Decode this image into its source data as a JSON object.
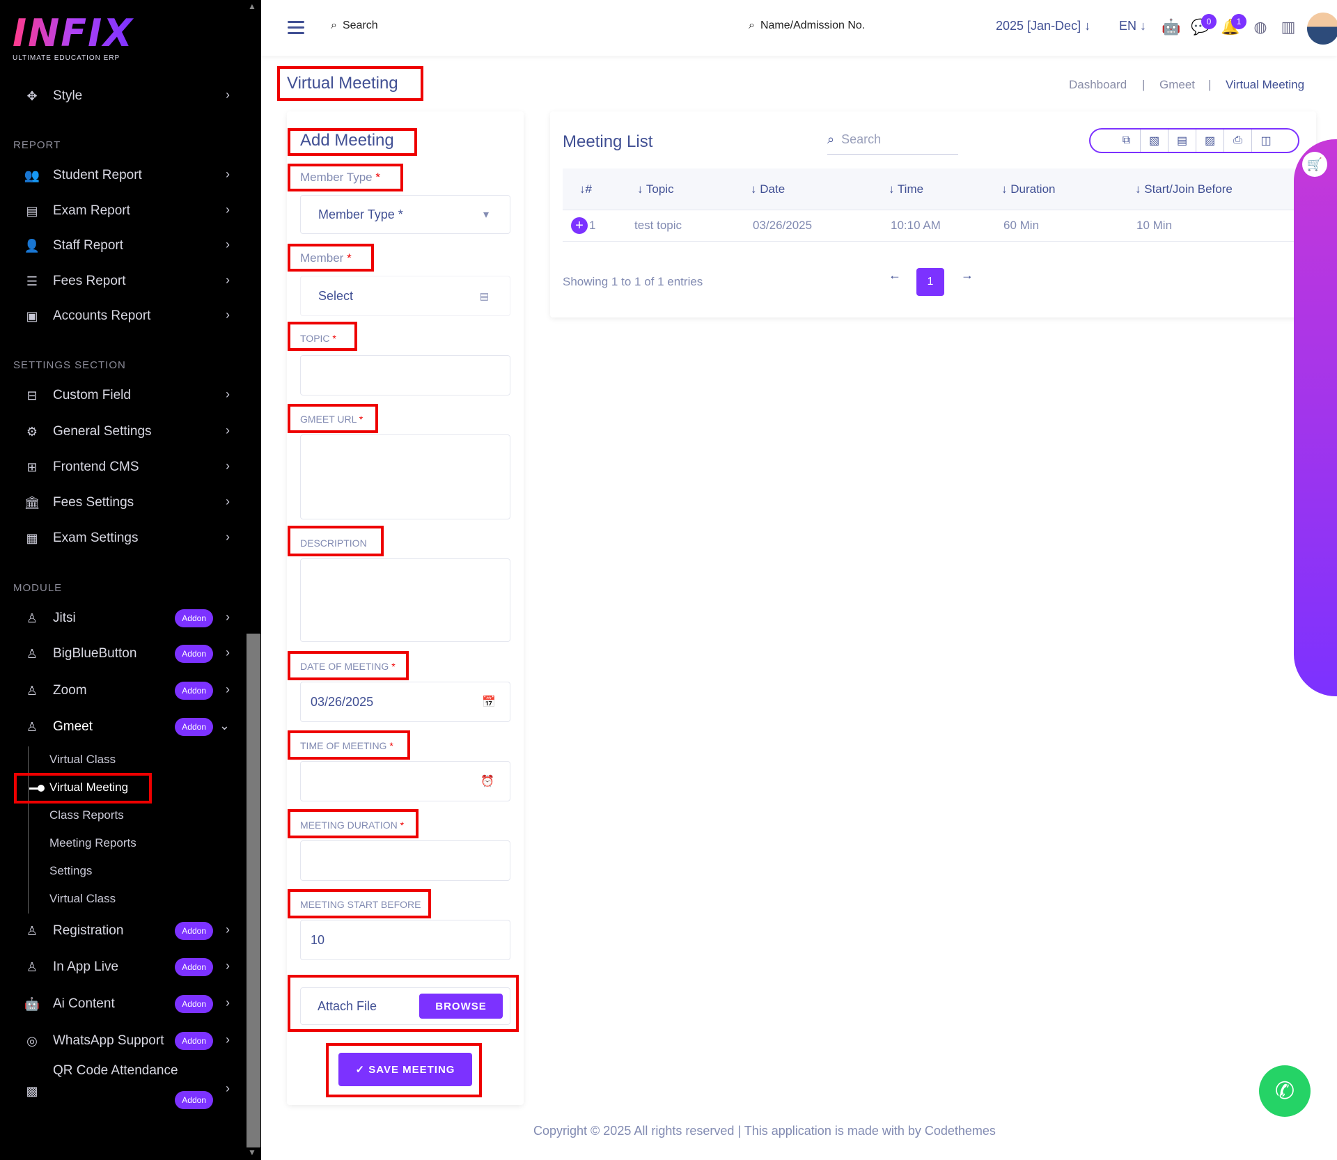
{
  "sidebar": {
    "logo": {
      "brand": "INFIX",
      "tagline": "ULTIMATE EDUCATION ERP"
    },
    "style_item": "Style",
    "sections": {
      "report": "REPORT",
      "settings": "SETTINGS SECTION",
      "module": "MODULE"
    },
    "report_items": [
      "Student Report",
      "Exam Report",
      "Staff Report",
      "Fees Report",
      "Accounts Report"
    ],
    "settings_items": [
      "Custom Field",
      "General Settings",
      "Frontend CMS",
      "Fees Settings",
      "Exam Settings"
    ],
    "module_items": [
      "Jitsi",
      "BigBlueButton",
      "Zoom",
      "Gmeet",
      "Registration",
      "In App Live",
      "Ai Content",
      "WhatsApp Support",
      "QR Code Attendance"
    ],
    "addon_label": "Addon",
    "gmeet_sub": [
      "Virtual Class",
      "Virtual Meeting",
      "Class Reports",
      "Meeting Reports",
      "Settings",
      "Virtual Class"
    ]
  },
  "header": {
    "search": "Search",
    "search2": "Name/Admission No.",
    "year": "2025 [Jan-Dec]",
    "lang": "EN",
    "msg_count": "0",
    "notif_count": "1"
  },
  "page": {
    "title": "Virtual Meeting",
    "breadcrumb": [
      "Dashboard",
      "Gmeet",
      "Virtual Meeting"
    ],
    "breadcrumb_sep": "|"
  },
  "form": {
    "title": "Add Meeting",
    "member_type_label": "Member Type",
    "member_type_value": "Member Type *",
    "member_label": "Member",
    "member_value": "Select",
    "topic_label": "TOPIC",
    "gmeet_url_label": "GMEET URL",
    "description_label": "DESCRIPTION",
    "date_label": "DATE OF MEETING",
    "date_value": "03/26/2025",
    "time_label": "TIME OF MEETING",
    "duration_label": "MEETING DURATION",
    "start_before_label": "MEETING START BEFORE",
    "start_before_value": "10",
    "attach_label": "Attach File",
    "browse": "BROWSE",
    "save": "✓ SAVE MEETING",
    "req": "*"
  },
  "list": {
    "title": "Meeting List",
    "search_placeholder": "Search",
    "columns": [
      "#",
      "Topic",
      "Date",
      "Time",
      "Duration",
      "Start/Join Before"
    ],
    "rows": [
      {
        "num": "1",
        "topic": "test topic",
        "date": "03/26/2025",
        "time": "10:10 AM",
        "duration": "60 Min",
        "start": "10 Min"
      }
    ],
    "showing": "Showing 1 to 1 of 1 entries",
    "page": "1"
  },
  "footer": "Copyright © 2025 All rights reserved | This application is made with by Codethemes",
  "colors": {
    "accent": "#7c32ff",
    "text": "#415094",
    "highlight": "#ee0000"
  }
}
